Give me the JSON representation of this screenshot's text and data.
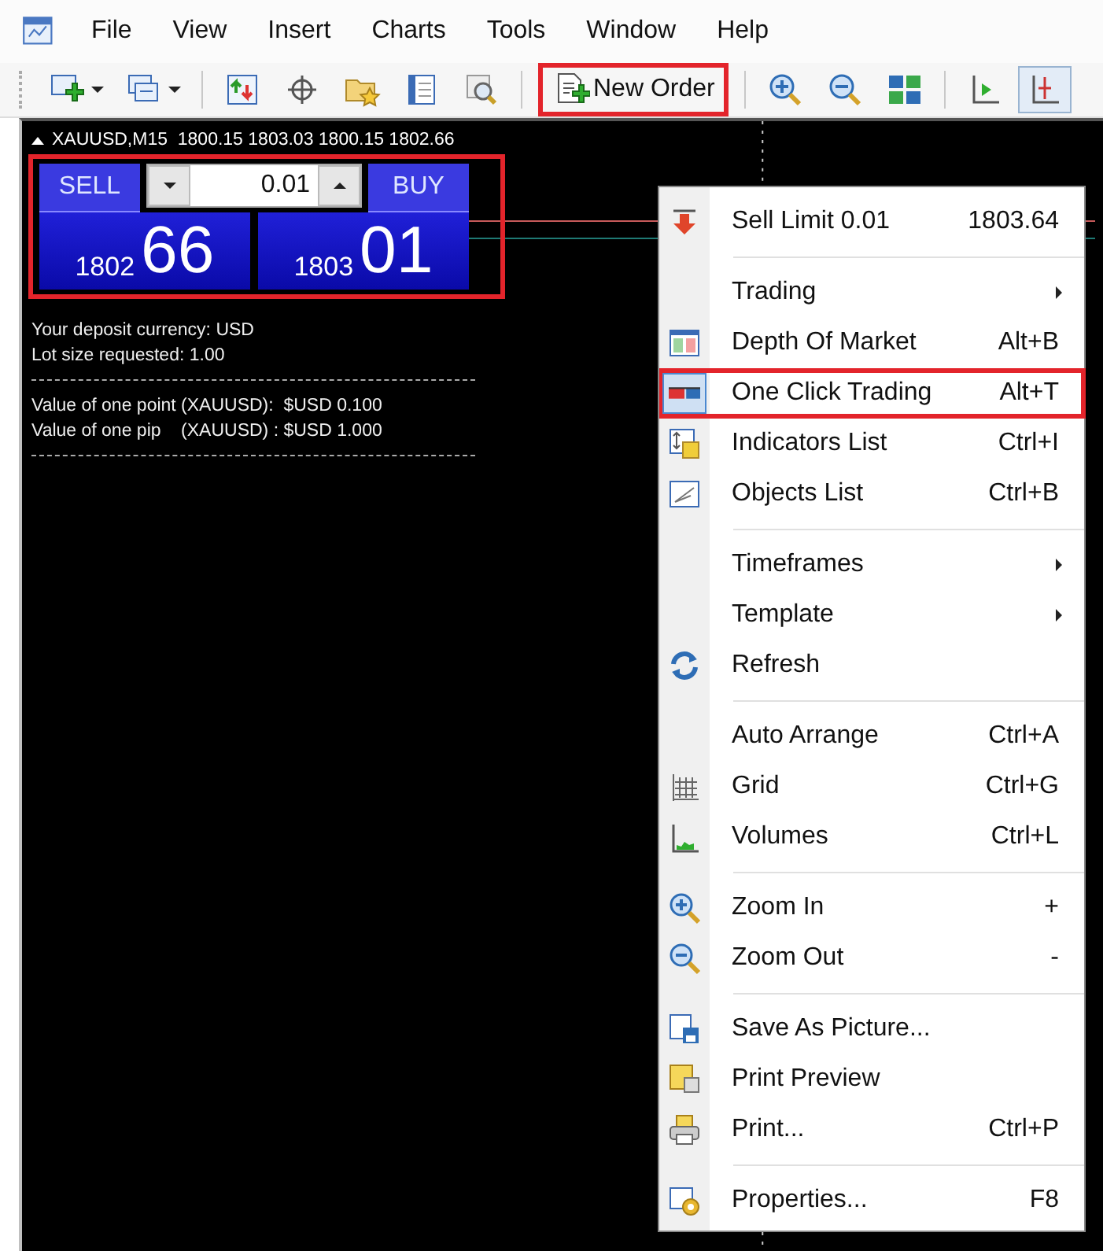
{
  "menu_bar": [
    "File",
    "View",
    "Insert",
    "Charts",
    "Tools",
    "Window",
    "Help"
  ],
  "toolbar": [
    {
      "kind": "icon",
      "dropdown": true,
      "pressed": false
    },
    {
      "kind": "icon",
      "dropdown": true,
      "pressed": false
    },
    {
      "kind": "separator"
    },
    {
      "kind": "icon",
      "dropdown": false,
      "pressed": false
    },
    {
      "kind": "icon",
      "dropdown": false,
      "pressed": false
    },
    {
      "kind": "icon",
      "dropdown": false,
      "pressed": false
    },
    {
      "kind": "icon",
      "dropdown": false,
      "pressed": false
    },
    {
      "kind": "icon",
      "dropdown": false,
      "pressed": false
    },
    {
      "kind": "separator"
    },
    {
      "kind": "text",
      "label": "New Order",
      "highlighted": true
    },
    {
      "kind": "separator"
    },
    {
      "kind": "icon",
      "dropdown": false,
      "pressed": false
    },
    {
      "kind": "icon",
      "dropdown": false,
      "pressed": false
    },
    {
      "kind": "icon",
      "dropdown": false,
      "pressed": false
    },
    {
      "kind": "separator"
    },
    {
      "kind": "icon",
      "dropdown": false,
      "pressed": false
    },
    {
      "kind": "icon",
      "dropdown": false,
      "pressed": true
    }
  ],
  "chart": {
    "title": "XAUUSD,M15  1800.15 1803.03 1800.15 1802.66",
    "one_click": {
      "highlighted": true,
      "sell_label": "SELL",
      "buy_label": "BUY",
      "lot": "0.01",
      "sell_prefix": "1802",
      "sell_digits": "66",
      "buy_prefix": "1803",
      "buy_digits": "01"
    },
    "info_lines": [
      {
        "kind": "text",
        "text": "Your deposit currency: USD"
      },
      {
        "kind": "text",
        "text": "Lot size requested: 1.00"
      },
      {
        "kind": "rule"
      },
      {
        "kind": "text",
        "text": "Value of one point (XAUUSD):  $USD 0.100"
      },
      {
        "kind": "text",
        "text": "Value of one pip    (XAUUSD) : $USD 1.000"
      },
      {
        "kind": "rule"
      }
    ]
  },
  "context_menu": [
    {
      "kind": "item",
      "label": "Sell Limit 0.01",
      "shortcut": "1803.64",
      "submenu": false,
      "checked": false,
      "highlighted": false
    },
    {
      "kind": "separator"
    },
    {
      "kind": "item",
      "label": "Trading",
      "submenu": true,
      "checked": false,
      "highlighted": false
    },
    {
      "kind": "item",
      "label": "Depth Of Market",
      "shortcut": "Alt+B",
      "submenu": false,
      "checked": false,
      "highlighted": false
    },
    {
      "kind": "item",
      "label": "One Click Trading",
      "shortcut": "Alt+T",
      "submenu": false,
      "checked": true,
      "highlighted": true
    },
    {
      "kind": "item",
      "label": "Indicators List",
      "shortcut": "Ctrl+I",
      "submenu": false,
      "checked": false,
      "highlighted": false
    },
    {
      "kind": "item",
      "label": "Objects List",
      "shortcut": "Ctrl+B",
      "submenu": false,
      "checked": false,
      "highlighted": false
    },
    {
      "kind": "separator"
    },
    {
      "kind": "item",
      "label": "Timeframes",
      "submenu": true,
      "checked": false,
      "highlighted": false
    },
    {
      "kind": "item",
      "label": "Template",
      "submenu": true,
      "checked": false,
      "highlighted": false
    },
    {
      "kind": "item",
      "label": "Refresh",
      "submenu": false,
      "checked": false,
      "highlighted": false
    },
    {
      "kind": "separator"
    },
    {
      "kind": "item",
      "label": "Auto Arrange",
      "shortcut": "Ctrl+A",
      "submenu": false,
      "checked": false,
      "highlighted": false
    },
    {
      "kind": "item",
      "label": "Grid",
      "shortcut": "Ctrl+G",
      "submenu": false,
      "checked": false,
      "highlighted": false
    },
    {
      "kind": "item",
      "label": "Volumes",
      "shortcut": "Ctrl+L",
      "submenu": false,
      "checked": false,
      "highlighted": false
    },
    {
      "kind": "separator"
    },
    {
      "kind": "item",
      "label": "Zoom In",
      "shortcut": "+",
      "submenu": false,
      "checked": false,
      "highlighted": false
    },
    {
      "kind": "item",
      "label": "Zoom Out",
      "shortcut": "-",
      "submenu": false,
      "checked": false,
      "highlighted": false
    },
    {
      "kind": "separator"
    },
    {
      "kind": "item",
      "label": "Save As Picture...",
      "submenu": false,
      "checked": false,
      "highlighted": false
    },
    {
      "kind": "item",
      "label": "Print Preview",
      "submenu": false,
      "checked": false,
      "highlighted": false
    },
    {
      "kind": "item",
      "label": "Print...",
      "shortcut": "Ctrl+P",
      "submenu": false,
      "checked": false,
      "highlighted": false
    },
    {
      "kind": "separator"
    },
    {
      "kind": "item",
      "label": "Properties...",
      "shortcut": "F8",
      "submenu": false,
      "checked": false,
      "highlighted": false
    }
  ]
}
